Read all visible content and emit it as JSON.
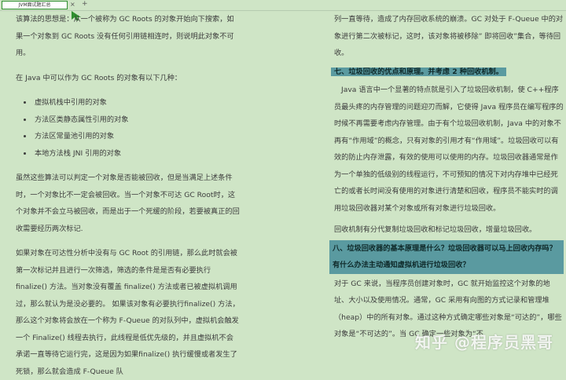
{
  "tab": {
    "title": "JVM面试题汇总",
    "close_glyph": "×",
    "add_glyph": "+"
  },
  "left": {
    "p1": "该算法的思想是：从一个被称为 GC Roots 的对象开始向下搜索，如果一个对象到 GC Roots 没有任何引用链相连时，则说明此对象不可用。",
    "p2": "在 Java 中可以作为 GC Roots 的对象有以下几种：",
    "bullets": [
      "虚拟机栈中引用的对象",
      "方法区类静态属性引用的对象",
      "方法区常量池引用的对象",
      "本地方法栈 JNI 引用的对象"
    ],
    "p3": "虽然这些算法可以判定一个对象是否能被回收，但是当满足上述条件时，一个对象比不一定会被回收。当一个对象不可达 GC Root时，这个对象并不会立马被回收，而是出于一个死缓的阶段，若要被真正的回收需要经历两次标记.",
    "p4": "如果对象在可达性分析中没有与 GC Root 的引用链，那么此时就会被第一次标记并且进行一次筛选，筛选的条件是是否有必要执行finalize() 方法。当对象没有覆盖 finalize() 方法或者已被虚拟机调用过，那么就认为是没必要的。 如果该对象有必要执行finalize() 方法，那么这个对象将会放在一个称为 F-Queue 的对队列中，虚拟机会触发一个 Finalize() 线程去执行，此线程是低优先级的，并且虚拟机不会承诺一直等待它运行完，这是因为如果finalize() 执行缓慢或者发生了死锁，那么就会造成 F-Queue 队"
  },
  "right": {
    "p1": "列一直等待，造成了内存回收系统的崩溃。GC 对处于 F-Queue 中的对象进行第二次被标记，这时，该对象将被移除” 即将回收”集合，等待回收。",
    "h7": "七、垃圾回收的优点和原理。并考虑 2 种回收机制。",
    "p2": "Java 语言中一个显著的特点就是引入了垃圾回收机制，使 C++程序员最头疼的内存管理的问题迎刃而解，它使得 Java 程序员在编写程序的时候不再需要考虑内存管理。由于有个垃圾回收机制，Java 中的对象不再有“作用域”的概念，只有对象的引用才有“作用域”。垃圾回收可以有效的防止内存泄露，有效的使用可以使用的内存。垃圾回收器通常是作为一个单独的低级别的线程运行，不可预知的情况下对内存堆中已经死亡的或者长时间没有使用的对象进行清楚和回收，程序员不能实时的调用垃圾回收器对某个对象或所有对象进行垃圾回收。",
    "p3": "回收机制有分代复制垃圾回收和标记垃圾回收，增量垃圾回收。",
    "h8": "八、垃圾回收器的基本原理是什么？垃圾回收器可以马上回收内存吗？有什么办法主动通知虚拟机进行垃圾回收？",
    "p4": "对于 GC 来说，当程序员创建对象时，GC 就开始监控这个对象的地址、大小以及使用情况。通常，GC 采用有向图的方式记录和管理堆（heap）中的所有对象。通过这种方式确定哪些对象是“可达的”，哪些对象是“不可达的”。当 GC 确定一些对象为“不"
  },
  "watermark": "知乎 @程序员黑哥",
  "colors": {
    "background": "#cfe5c6",
    "heading": "#5a9aa0",
    "tab_border": "#2f8f2f"
  }
}
